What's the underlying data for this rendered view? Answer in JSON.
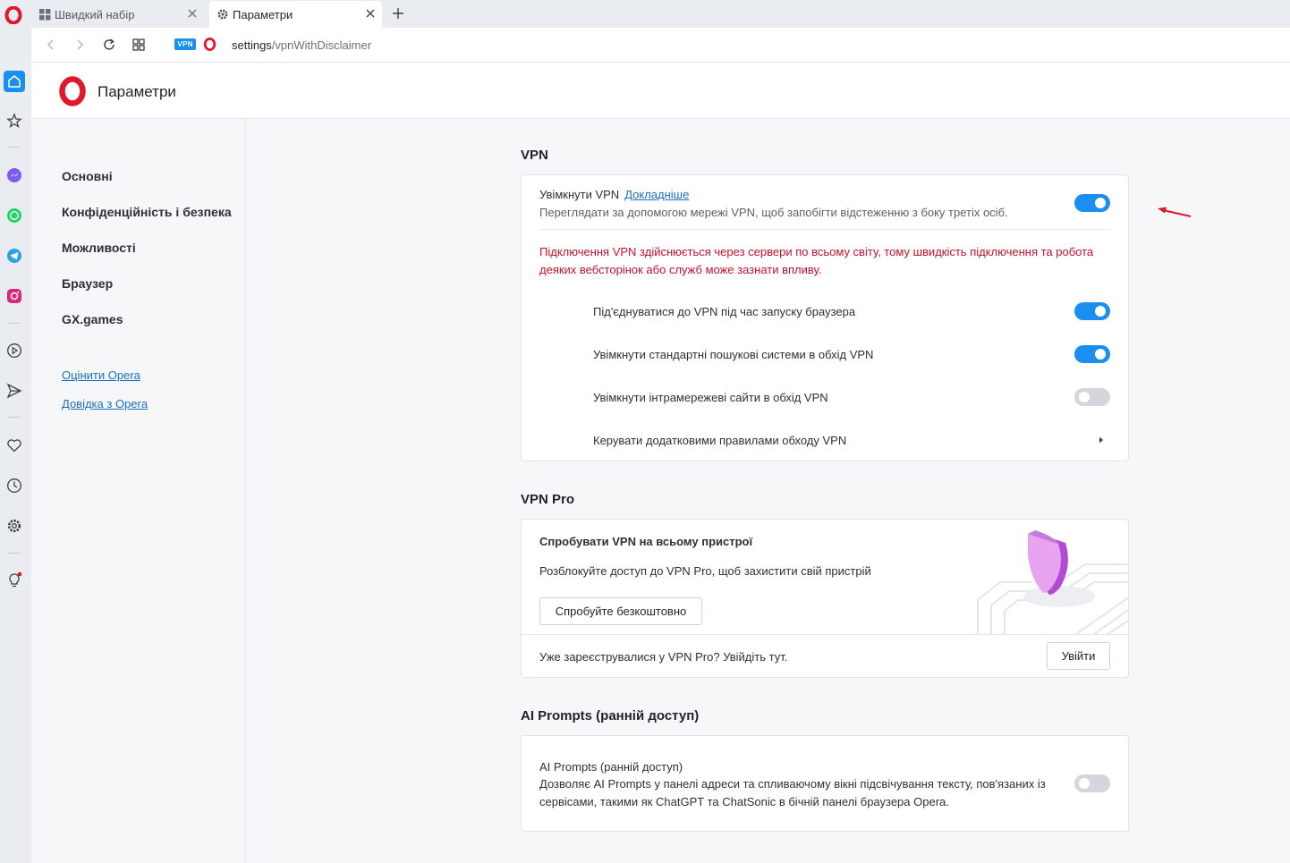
{
  "tabs": [
    {
      "label": "Швидкий набір",
      "icon": "grid-icon"
    },
    {
      "label": "Параметри",
      "icon": "gear-icon"
    }
  ],
  "address_bar": {
    "vpn_badge": "VPN",
    "url_host": "settings",
    "url_path": "/vpnWithDisclaimer"
  },
  "header": {
    "title": "Параметри"
  },
  "nav": {
    "items": [
      "Основні",
      "Конфіденційність і безпека",
      "Можливості",
      "Браузер",
      "GX.games"
    ],
    "links": [
      "Оцінити Opera",
      "Довідка з Opera"
    ]
  },
  "vpn": {
    "section_title": "VPN",
    "enable_label": "Увімкнути VPN",
    "learn_more": "Докладніше",
    "enable_desc": "Переглядати за допомогою мережі VPN, щоб запобігти відстеженню з боку третіх осіб.",
    "enabled": true,
    "warning": "Підключення VPN здійснюється через сервери по всьому світу, тому швидкість підключення та робота деяких вебсторінок або служб може зазнати впливу.",
    "options": [
      {
        "label": "Під'єднуватися до VPN під час запуску браузера",
        "on": true
      },
      {
        "label": "Увімкнути стандартні пошукові системи в обхід VPN",
        "on": true
      },
      {
        "label": "Увімкнути інтрамережеві сайти в обхід VPN",
        "on": false
      }
    ],
    "manage_rules": "Керувати додатковими правилами обходу VPN"
  },
  "vpn_pro": {
    "section_title": "VPN Pro",
    "headline": "Спробувати VPN на всьому пристрої",
    "desc": "Розблокуйте доступ до VPN Pro, щоб захистити свій пристрій",
    "try_button": "Спробуйте безкоштовно",
    "registered_text": "Уже зареєструвалися у VPN Pro? Увійдіть тут.",
    "login_button": "Увійти"
  },
  "ai": {
    "section_title": "AI Prompts (ранній доступ)",
    "title": "AI Prompts (ранній доступ)",
    "desc": "Дозволяє AI Prompts у панелі адреси та спливаючому вікні підсвічування тексту, пов'язаних із сервісами, такими як ChatGPT та ChatSonic в бічній панелі браузера Opera.",
    "enabled": false
  },
  "colors": {
    "accent": "#1b8ff0",
    "warning": "#c8102e",
    "opera_red": "#e0182d"
  }
}
